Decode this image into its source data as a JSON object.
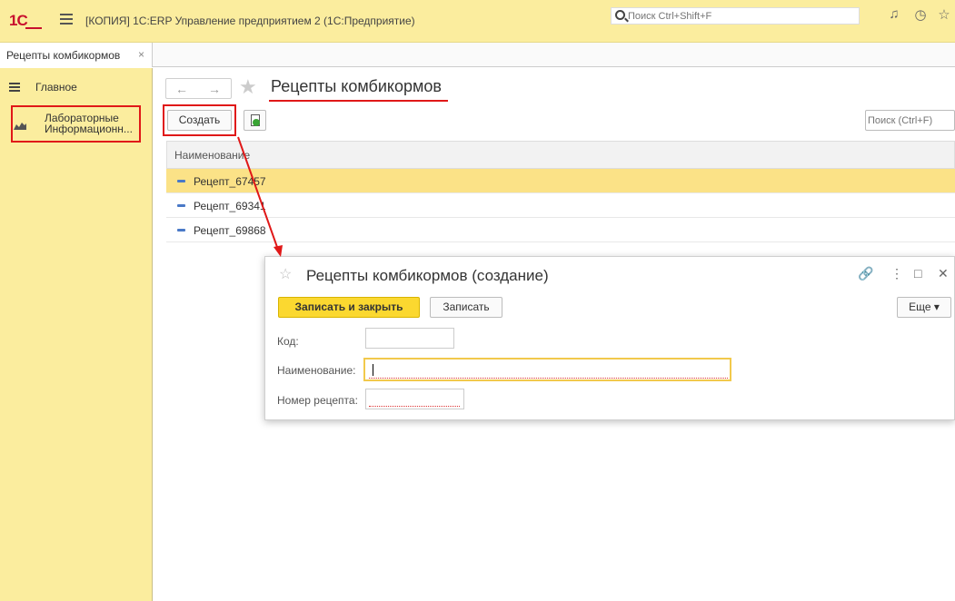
{
  "titlebar": {
    "logo": "1С",
    "app_title": "[КОПИЯ] 1С:ERP Управление предприятием 2  (1С:Предприятие)",
    "search_placeholder": "Поиск Ctrl+Shift+F"
  },
  "tabs": [
    {
      "label": "Рецепты комбикормов",
      "close": "×"
    }
  ],
  "sidebar": {
    "items": [
      {
        "label": "Главное",
        "icon": "list-icon"
      },
      {
        "label_line1": "Лабораторные",
        "label_line2": "Информационн...",
        "icon": "lab-chart-icon"
      }
    ]
  },
  "page": {
    "title": "Рецепты комбикормов",
    "create_label": "Создать",
    "search_placeholder": "Поиск (Ctrl+F)",
    "table": {
      "column": "Наименование",
      "rows": [
        "Рецепт_67457",
        "Рецепт_69341",
        "Рецепт_69868"
      ]
    }
  },
  "modal": {
    "title": "Рецепты комбикормов (создание)",
    "save_close_label": "Записать и закрыть",
    "save_label": "Записать",
    "more_label": "Еще ▾",
    "fields": {
      "code_label": "Код:",
      "code_value": "",
      "name_label": "Наименование:",
      "name_value": "",
      "number_label": "Номер рецепта:",
      "number_value": ""
    }
  },
  "colors": {
    "accent": "#fbed9e",
    "highlight": "#e01818",
    "selected_row": "#fbe287",
    "primary_button": "#fbd830"
  }
}
